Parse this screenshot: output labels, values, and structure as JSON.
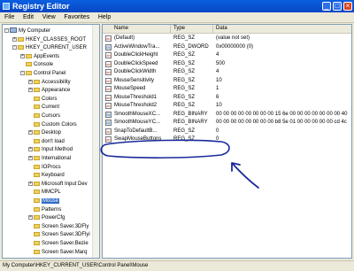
{
  "window": {
    "title": "Registry Editor"
  },
  "menu": [
    "File",
    "Edit",
    "View",
    "Favorites",
    "Help"
  ],
  "tree": [
    {
      "label": "My Computer",
      "depth": 0,
      "icon": "computer-icon",
      "exp": "-"
    },
    {
      "label": "HKEY_CLASSES_ROOT",
      "depth": 1,
      "icon": "folder-icon",
      "exp": "+"
    },
    {
      "label": "HKEY_CURRENT_USER",
      "depth": 1,
      "icon": "folder-icon",
      "exp": "-"
    },
    {
      "label": "AppEvents",
      "depth": 2,
      "icon": "folder-icon",
      "exp": "+"
    },
    {
      "label": "Console",
      "depth": 2,
      "icon": "folder-icon",
      "exp": ""
    },
    {
      "label": "Control Panel",
      "depth": 2,
      "icon": "folder-icon",
      "exp": "-"
    },
    {
      "label": "Accessibility",
      "depth": 3,
      "icon": "folder-icon",
      "exp": "+"
    },
    {
      "label": "Appearance",
      "depth": 3,
      "icon": "folder-icon",
      "exp": "+"
    },
    {
      "label": "Colors",
      "depth": 3,
      "icon": "folder-icon",
      "exp": ""
    },
    {
      "label": "Current",
      "depth": 3,
      "icon": "folder-icon",
      "exp": ""
    },
    {
      "label": "Cursors",
      "depth": 3,
      "icon": "folder-icon",
      "exp": ""
    },
    {
      "label": "Custom Colors",
      "depth": 3,
      "icon": "folder-icon",
      "exp": ""
    },
    {
      "label": "Desktop",
      "depth": 3,
      "icon": "folder-icon",
      "exp": "+"
    },
    {
      "label": "don't load",
      "depth": 3,
      "icon": "folder-icon",
      "exp": ""
    },
    {
      "label": "Input Method",
      "depth": 3,
      "icon": "folder-icon",
      "exp": "+"
    },
    {
      "label": "International",
      "depth": 3,
      "icon": "folder-icon",
      "exp": "+"
    },
    {
      "label": "IOProcs",
      "depth": 3,
      "icon": "folder-icon",
      "exp": ""
    },
    {
      "label": "Keyboard",
      "depth": 3,
      "icon": "folder-icon",
      "exp": ""
    },
    {
      "label": "Microsoft Input Dev",
      "depth": 3,
      "icon": "folder-icon",
      "exp": "+"
    },
    {
      "label": "MMCPL",
      "depth": 3,
      "icon": "folder-icon",
      "exp": ""
    },
    {
      "label": "Mouse",
      "depth": 3,
      "icon": "folder-icon",
      "exp": "",
      "selected": true
    },
    {
      "label": "Patterns",
      "depth": 3,
      "icon": "folder-icon",
      "exp": ""
    },
    {
      "label": "PowerCfg",
      "depth": 3,
      "icon": "folder-icon",
      "exp": "+"
    },
    {
      "label": "Screen Saver.3DFly",
      "depth": 3,
      "icon": "folder-icon",
      "exp": ""
    },
    {
      "label": "Screen Saver.3DFlyi",
      "depth": 3,
      "icon": "folder-icon",
      "exp": ""
    },
    {
      "label": "Screen Saver.Bezie",
      "depth": 3,
      "icon": "folder-icon",
      "exp": ""
    },
    {
      "label": "Screen Saver.Marq",
      "depth": 3,
      "icon": "folder-icon",
      "exp": ""
    }
  ],
  "columns": [
    "Name",
    "Type",
    "Data"
  ],
  "values": [
    {
      "name": "(Default)",
      "type": "REG_SZ",
      "data": "(value not set)",
      "icon": "string-value-icon"
    },
    {
      "name": "ActiveWindowTra...",
      "type": "REG_DWORD",
      "data": "0x00000000 (0)",
      "icon": "binary-value-icon"
    },
    {
      "name": "DoubleClickHeight",
      "type": "REG_SZ",
      "data": "4",
      "icon": "string-value-icon"
    },
    {
      "name": "DoubleClickSpeed",
      "type": "REG_SZ",
      "data": "500",
      "icon": "string-value-icon"
    },
    {
      "name": "DoubleClickWidth",
      "type": "REG_SZ",
      "data": "4",
      "icon": "string-value-icon"
    },
    {
      "name": "MouseSensitivity",
      "type": "REG_SZ",
      "data": "10",
      "icon": "string-value-icon"
    },
    {
      "name": "MouseSpeed",
      "type": "REG_SZ",
      "data": "1",
      "icon": "string-value-icon"
    },
    {
      "name": "MouseThreshold1",
      "type": "REG_SZ",
      "data": "6",
      "icon": "string-value-icon"
    },
    {
      "name": "MouseThreshold2",
      "type": "REG_SZ",
      "data": "10",
      "icon": "string-value-icon"
    },
    {
      "name": "SmoothMouseXC...",
      "type": "REG_BINARY",
      "data": "00 00 00 00 00 00 00 00 15 6e 00 00 00 00 00 00 00 40",
      "icon": "binary-value-icon"
    },
    {
      "name": "SmoothMouseYC...",
      "type": "REG_BINARY",
      "data": "00 00 00 00 00 00 00 00 b8 5e 01 00 00 00 00 00 cd 4c",
      "icon": "binary-value-icon"
    },
    {
      "name": "SnapToDefaultB...",
      "type": "REG_SZ",
      "data": "0",
      "icon": "string-value-icon"
    },
    {
      "name": "SwapMouseButtons",
      "type": "REG_SZ",
      "data": "0",
      "icon": "string-value-icon",
      "highlighted": true
    }
  ],
  "status_text": "My Computer\\HKEY_CURRENT_USER\\Control Panel\\Mouse",
  "colors": {
    "annotation": "#1a2a9a",
    "selection": "#316ac5"
  }
}
